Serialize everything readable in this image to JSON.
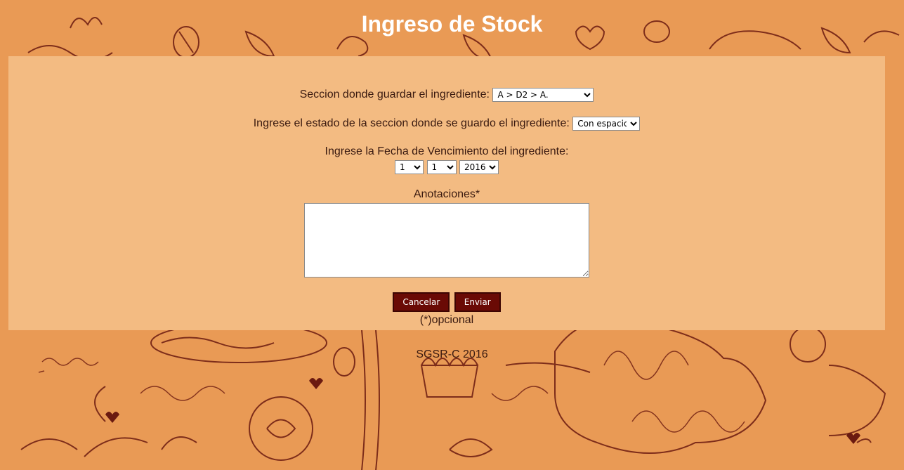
{
  "page": {
    "title": "Ingreso de Stock"
  },
  "form": {
    "section_label": "Seccion donde guardar el ingrediente:",
    "section_value": "A > D2 > A.",
    "status_label": "Ingrese el estado de la seccion donde se guardo el ingrediente:",
    "status_value": "Con espacio",
    "expiry_label": "Ingrese la Fecha de Vencimiento del ingrediente:",
    "expiry_day": "1",
    "expiry_month": "1",
    "expiry_year": "2016",
    "notes_label": "Anotaciones*",
    "notes_value": "",
    "cancel_label": "Cancelar",
    "submit_label": "Enviar",
    "optional_note": "(*)opcional"
  },
  "footer": {
    "text": "SGSR-C 2016"
  },
  "colors": {
    "background": "#e99a55",
    "panel": "#f3bb82",
    "button": "#6a0a05",
    "doodle": "#6b1a10"
  }
}
